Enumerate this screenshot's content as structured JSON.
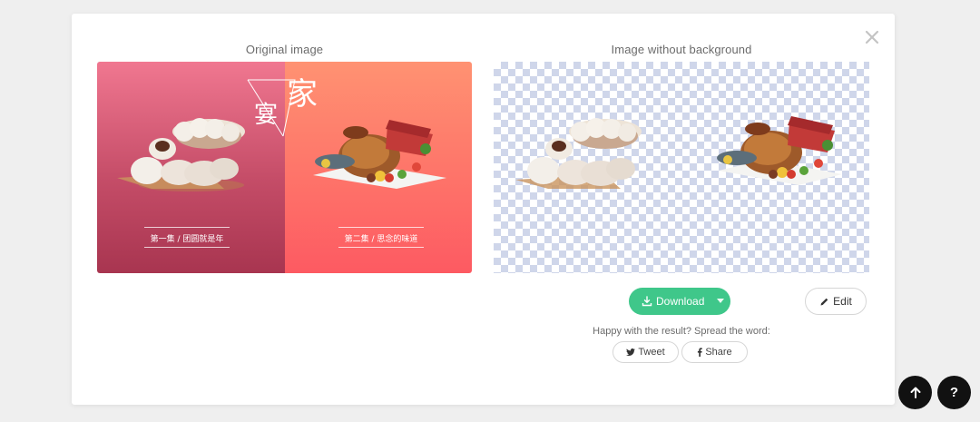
{
  "panels": {
    "original_title": "Original image",
    "nobg_title": "Image without background"
  },
  "poster": {
    "char_large": "家",
    "char_small": "宴",
    "caption_left": "第一集 / 团圆就是年",
    "caption_right": "第二集 / 思念的味道",
    "colors": {
      "left": "#b9435f",
      "right": "#ff7c6a"
    }
  },
  "actions": {
    "download_label": "Download",
    "edit_label": "Edit",
    "spread_text": "Happy with the result? Spread the word:",
    "tweet_label": "Tweet",
    "share_label": "Share"
  },
  "icons": {
    "close": "close-icon",
    "download": "download-icon",
    "edit": "pencil-icon",
    "twitter": "twitter-icon",
    "facebook": "facebook-icon",
    "to_top": "arrow-up-icon",
    "help": "question-icon"
  },
  "floating": {
    "help_label": "?"
  },
  "accent": "#3fc78a"
}
